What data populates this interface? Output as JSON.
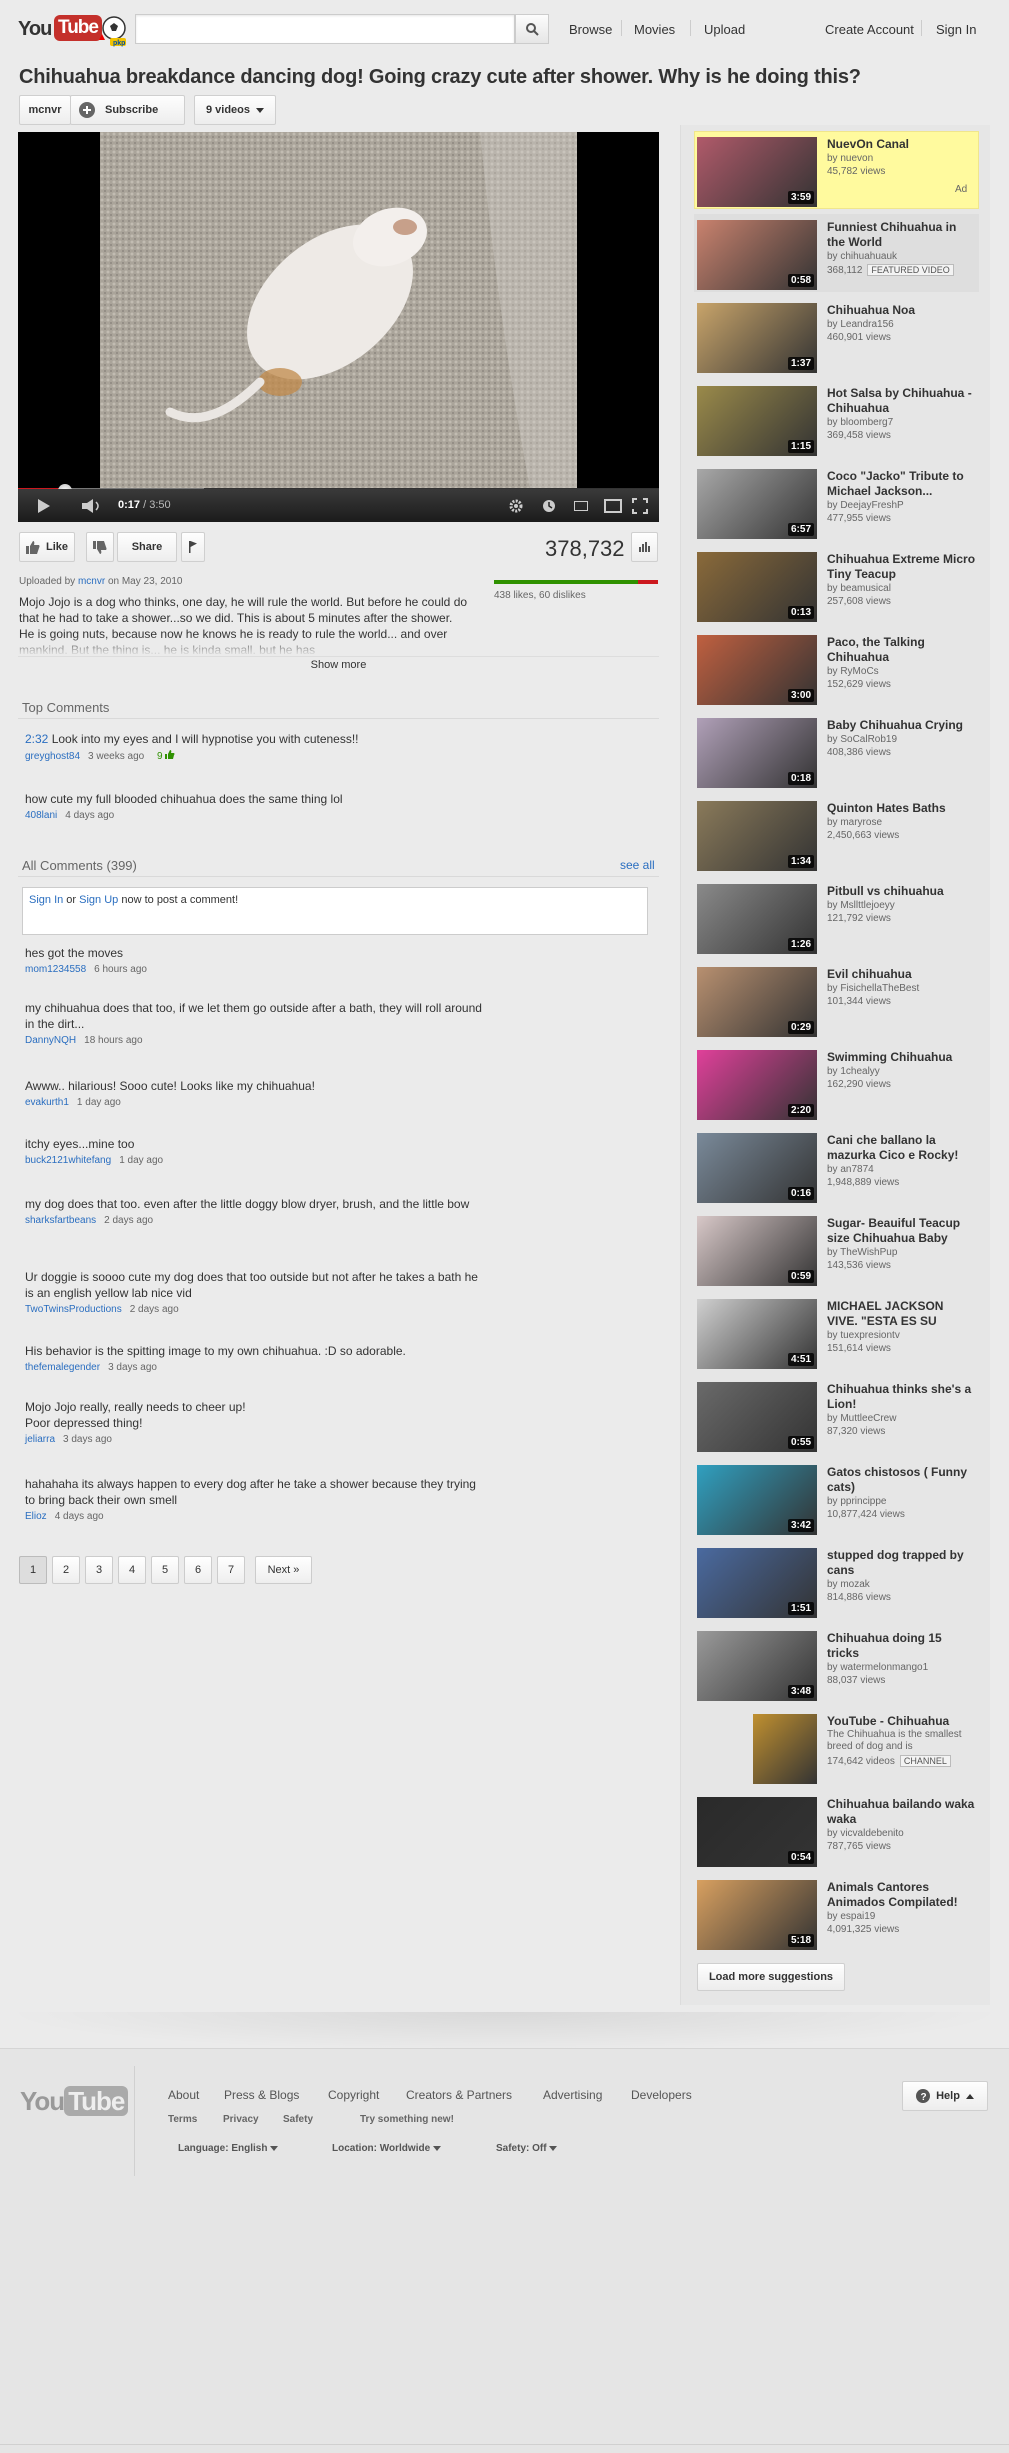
{
  "header": {
    "logo_text_you": "You",
    "logo_text_tube": "Tube",
    "search_placeholder": "",
    "nav": [
      "Browse",
      "Movies",
      "Upload"
    ],
    "account": [
      "Create Account",
      "Sign In"
    ]
  },
  "video": {
    "title": "Chihuahua breakdance dancing dog! Going crazy cute after shower. Why is he doing this?",
    "channel": "mcnvr",
    "subscribe_label": "Subscribe",
    "videos_label": "9 videos",
    "current_time": "0:17",
    "total_time": "3:50",
    "progress_fraction": 0.074,
    "buffered_fraction": 0.29,
    "like_label": "Like",
    "share_label": "Share",
    "view_count": "378,732",
    "likes_text": "438 likes, 60 dislikes",
    "like_ratio": 0.88,
    "uploaded_prefix": "Uploaded by",
    "uploaded_by": "mcnvr",
    "uploaded_on": "on May 23, 2010",
    "description": "Mojo Jojo is a dog who thinks, one day, he will rule the world. But before he could do that he had to take a shower...so we did. This is about 5 minutes after the shower. He is going nuts, because now he knows he is ready to rule the world... and over mankind. But the thing is... he is kinda small, but he has",
    "show_more": "Show more"
  },
  "top_comments": {
    "title": "Top Comments",
    "items": [
      {
        "link": "2:32",
        "text": " Look into my eyes and I will hypnotise you with cuteness!!",
        "user": "greyghost84",
        "time": "3 weeks ago",
        "votes": "9"
      },
      {
        "link": "",
        "text": "how cute my full blooded chihuahua does the same thing lol",
        "user": "408lani",
        "time": "4 days ago",
        "votes": ""
      }
    ]
  },
  "all_comments": {
    "title": "All Comments (399)",
    "see_all": "see all",
    "signin": "Sign In",
    "or": " or ",
    "signup": "Sign Up",
    "post_suffix": " now to post a comment!",
    "items": [
      {
        "text": "hes got the moves",
        "user": "mom1234558",
        "time": "6 hours ago"
      },
      {
        "text": "my chihuahua does that too, if we let them go outside after a bath, they will roll around in the dirt...",
        "user": "DannyNQH",
        "time": "18 hours ago"
      },
      {
        "text": "Awww.. hilarious! Sooo cute! Looks like my chihuahua!",
        "user": "evakurth1",
        "time": "1 day ago"
      },
      {
        "text": "itchy eyes...mine too",
        "user": "buck2121whitefang",
        "time": "1 day ago"
      },
      {
        "text": "my dog does that too. even after the little doggy blow dryer, brush, and the little bow",
        "user": "sharksfartbeans",
        "time": "2 days ago"
      },
      {
        "text": "Ur doggie is soooo cute my dog does that too outside but not after he takes a bath he is an english yellow lab nice vid",
        "user": "TwoTwinsProductions",
        "time": "2 days ago"
      },
      {
        "text": "His behavior is the spitting image to my own chihuahua. :D so adorable.",
        "user": "thefemalegender",
        "time": "3 days ago"
      },
      {
        "text": "Mojo Jojo really, really needs to cheer up!\nPoor depressed thing!",
        "user": "jeliarra",
        "time": "3 days ago"
      },
      {
        "text": "hahahaha its always happen to every dog after he take a shower because they trying to bring back their own smell",
        "user": "Elioz",
        "time": "4 days ago"
      }
    ],
    "pages": [
      "1",
      "2",
      "3",
      "4",
      "5",
      "6",
      "7"
    ],
    "next": "Next »"
  },
  "related": [
    {
      "title": "NuevOn Canal",
      "by": "by nuevon",
      "views": "45,782 views",
      "dur": "3:59",
      "ad": "Ad",
      "color": "#b05a6a"
    },
    {
      "title": "Funniest Chihuahua in the World",
      "by": "by chihuahuauk",
      "views": "368,112",
      "badge": "FEATURED VIDEO",
      "dur": "0:58",
      "color": "#c9826e"
    },
    {
      "title": "Chihuahua Noa",
      "by": "by Leandra156",
      "views": "460,901 views",
      "dur": "1:37",
      "color": "#c8a46a"
    },
    {
      "title": "Hot Salsa by Chihuahua - Chihuahua",
      "by": "by bloomberg7",
      "views": "369,458 views",
      "dur": "1:15",
      "color": "#9a8a4a"
    },
    {
      "title": "Coco \"Jacko\" Tribute to Michael Jackson...",
      "by": "by DeejayFreshP",
      "views": "477,955 views",
      "dur": "6:57",
      "color": "#a8a8a8"
    },
    {
      "title": "Chihuahua Extreme Micro Tiny Teacup",
      "by": "by beamusical",
      "views": "257,608 views",
      "dur": "0:13",
      "color": "#8a6a3a"
    },
    {
      "title": "Paco, the Talking Chihuahua",
      "by": "by RyMoCs",
      "views": "152,629 views",
      "dur": "3:00",
      "color": "#c06040"
    },
    {
      "title": "Baby Chihuahua Crying",
      "by": "by SoCalRob19",
      "views": "408,386 views",
      "dur": "0:18",
      "color": "#b0a0b8"
    },
    {
      "title": "Quinton Hates Baths",
      "by": "by maryrose",
      "views": "2,450,663 views",
      "dur": "1:34",
      "color": "#8a7a5a"
    },
    {
      "title": "Pitbull vs chihuahua",
      "by": "by Msllttlejoeyy",
      "views": "121,792 views",
      "dur": "1:26",
      "color": "#8a8a8a"
    },
    {
      "title": "Evil chihuahua",
      "by": "by FisichellaTheBest",
      "views": "101,344 views",
      "dur": "0:29",
      "color": "#b89070"
    },
    {
      "title": "Swimming Chihuahua",
      "by": "by 1chealyy",
      "views": "162,290 views",
      "dur": "2:20",
      "color": "#e0409a"
    },
    {
      "title": "Cani che ballano la mazurka Cico e Rocky!",
      "by": "by an7874",
      "views": "1,948,889 views",
      "dur": "0:16",
      "color": "#7a8a9a"
    },
    {
      "title": "Sugar- Beauiful Teacup size Chihuahua Baby",
      "by": "by TheWishPup",
      "views": "143,536 views",
      "dur": "0:59",
      "color": "#d8c8c8"
    },
    {
      "title": "MICHAEL JACKSON VIVE. \"ESTA ES SU",
      "by": "by tuexpresiontv",
      "views": "151,614 views",
      "dur": "4:51",
      "color": "#d0d0d0"
    },
    {
      "title": "Chihuahua thinks she's a Lion!",
      "by": "by MuttleeCrew",
      "views": "87,320 views",
      "dur": "0:55",
      "color": "#6a6a6a"
    },
    {
      "title": "Gatos chistosos ( Funny cats)",
      "by": "by pprincippe",
      "views": "10,877,424 views",
      "dur": "3:42",
      "color": "#30a0c0"
    },
    {
      "title": "stupped dog trapped by cans",
      "by": "by mozak",
      "views": "814,886 views",
      "dur": "1:51",
      "color": "#4a6aa0"
    },
    {
      "title": "Chihuahua doing 15 tricks",
      "by": "by watermelonmango1",
      "views": "88,037 views",
      "dur": "3:48",
      "color": "#9a9a9a"
    },
    {
      "title": "YouTube - Chihuahua",
      "by": "The Chihuahua is the smallest breed of dog and is",
      "views": "174,642 videos",
      "badge": "CHANNEL",
      "dur": "",
      "color": "#c09030"
    },
    {
      "title": "Chihuahua bailando waka waka",
      "by": "by vicvaldebenito",
      "views": "787,765 views",
      "dur": "0:54",
      "color": "#2a2a2a"
    },
    {
      "title": "Animals Cantores Animados Compilated!",
      "by": "by espai19",
      "views": "4,091,325 views",
      "dur": "5:18",
      "color": "#d8a060"
    }
  ],
  "load_more": "Load more suggestions",
  "footer": {
    "logo_you": "You",
    "logo_tube": "Tube",
    "links": [
      "About",
      "Press & Blogs",
      "Copyright",
      "Creators & Partners",
      "Advertising",
      "Developers"
    ],
    "links2": [
      "Terms",
      "Privacy",
      "Safety",
      "Try something new!"
    ],
    "language": "Language: English",
    "location": "Location: Worldwide",
    "safety": "Safety: Off",
    "help": "Help"
  }
}
